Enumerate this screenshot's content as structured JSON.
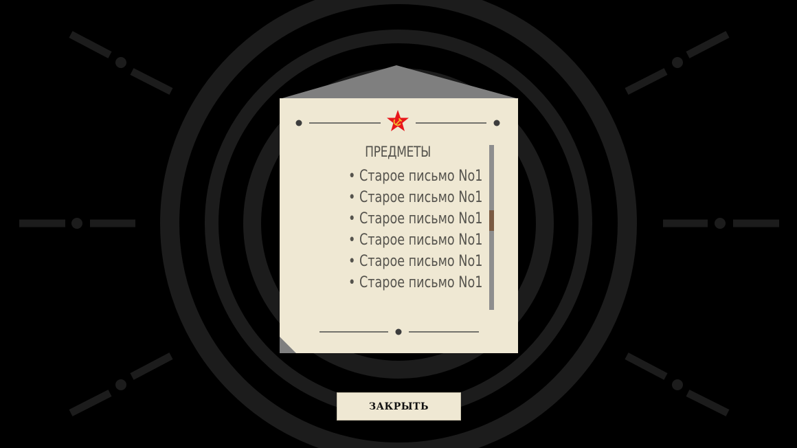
{
  "inventory": {
    "title": "ПРЕДМЕТЫ",
    "items": [
      "• Старое письмо No1",
      "• Старое письмо No1",
      "• Старое письмо No1",
      "• Старое письмо No1",
      "• Старое письмо No1",
      "• Старое письмо No1"
    ],
    "scroll_position": 0.45
  },
  "close_button": {
    "label": "ЗАКРЫТЬ"
  },
  "icons": {
    "emblem": "red-star-hammer-sickle-icon"
  },
  "colors": {
    "background": "#000000",
    "rings": "#1c1c1c",
    "panel": "#efe8d3",
    "roof": "#7f7f7f",
    "text": "#55534d",
    "star": "#e8161b",
    "emblem": "#f4c430",
    "scroll_track": "#8e8e8e",
    "scroll_thumb": "#7a5a42"
  }
}
